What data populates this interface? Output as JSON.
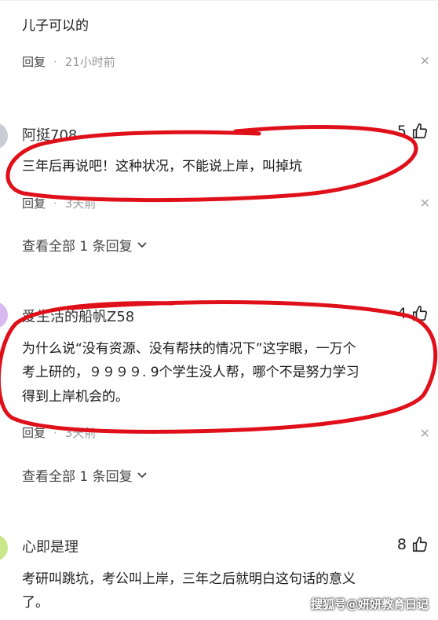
{
  "comments": [
    {
      "text": "儿子可以的",
      "reply_label": "回复",
      "time": "21小时前"
    },
    {
      "username": "阿挺708",
      "likes": "5",
      "text": "三年后再说吧！这种状况，不能说上岸，叫掉坑",
      "reply_label": "回复",
      "time": "3天前",
      "view_all": "查看全部 1 条回复"
    },
    {
      "username": "爱生活的船帆Z58",
      "likes": "4",
      "text_lines": [
        "为什么说“没有资源、没有帮扶的情况下”这字眼，一万个",
        "考上研的，９９９９. 9个学生没人帮，哪个不是努力学习",
        "得到上岸机会的。"
      ],
      "reply_label": "回复",
      "time": "3天前",
      "view_all": "查看全部 1 条回复"
    },
    {
      "username": "心即是理",
      "likes": "8",
      "text_lines": [
        "考研叫跳坑，考公叫上岸，三年之后就明白这句话的意义",
        "了。"
      ]
    }
  ],
  "watermark": "搜狐号@妍妍教育日记",
  "colors": {
    "annotation": "#e0101a",
    "meta": "#999999",
    "avatar_1": "#c9ccd2",
    "avatar_2": "#d8b8f0",
    "avatar_3": "#c8e88a"
  },
  "icons": [
    "thumbs-up-icon",
    "close-icon",
    "chevron-down-icon"
  ]
}
